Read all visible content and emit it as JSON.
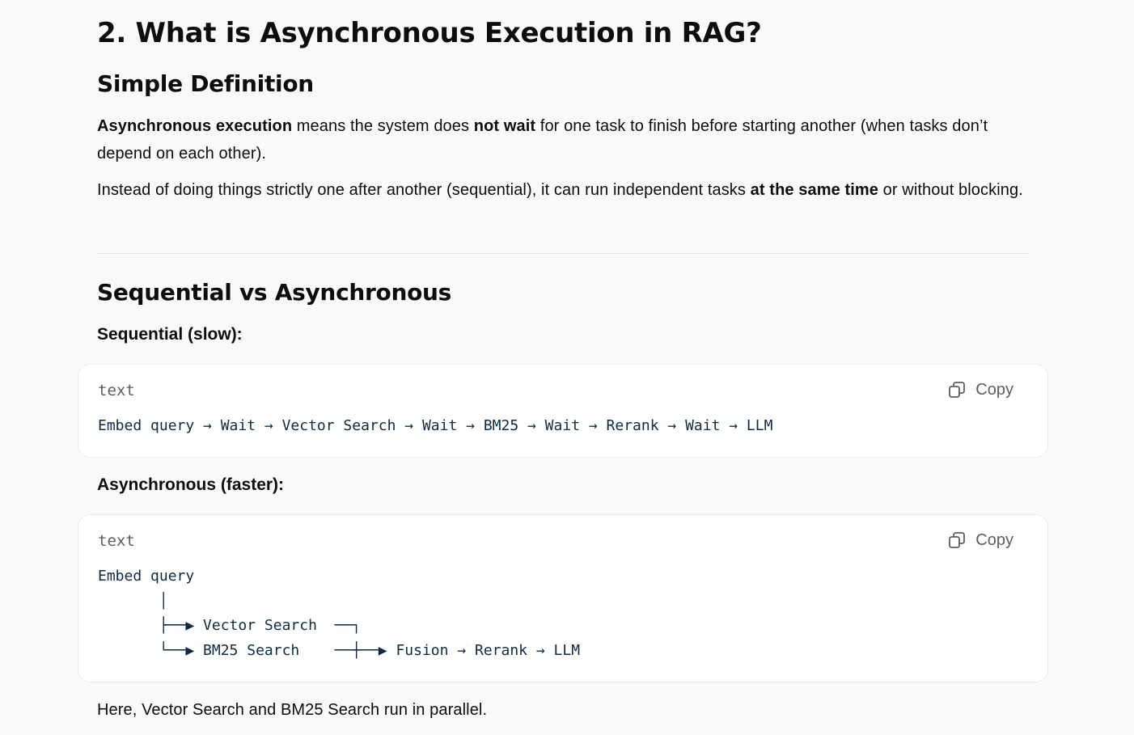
{
  "heading": "2. What is Asynchronous Execution in RAG?",
  "simple_definition": {
    "title": "Simple Definition",
    "p1": {
      "bold1": "Asynchronous execution",
      "text1": " means the system does ",
      "bold2": "not wait",
      "text2": " for one task to finish before starting another (when tasks don’t depend on each other)."
    },
    "p2": {
      "text1": "Instead of doing things strictly one after another (sequential), it can run independent tasks ",
      "bold1": "at the same time",
      "text2": " or without blocking."
    }
  },
  "comparison": {
    "title": "Sequential vs Asynchronous",
    "sequential": {
      "label": "Sequential (slow):",
      "code_lang": "text",
      "copy_label": "Copy",
      "code": "Embed query → Wait → Vector Search → Wait → BM25 → Wait → Rerank → Wait → LLM"
    },
    "asynchronous": {
      "label": "Asynchronous (faster):",
      "code_lang": "text",
      "copy_label": "Copy",
      "code": "Embed query\n       │\n       ├──▶ Vector Search  ──┐\n       └──▶ BM25 Search    ──┼──▶ Fusion → Rerank → LLM"
    },
    "footer": "Here, Vector Search and BM25 Search run in parallel."
  },
  "icons": {
    "copy": "copy-icon"
  },
  "colors": {
    "background": "#f9f9f9",
    "code_bg": "#ffffff",
    "code_text": "#0d2b45",
    "muted": "#5d5d5d"
  }
}
